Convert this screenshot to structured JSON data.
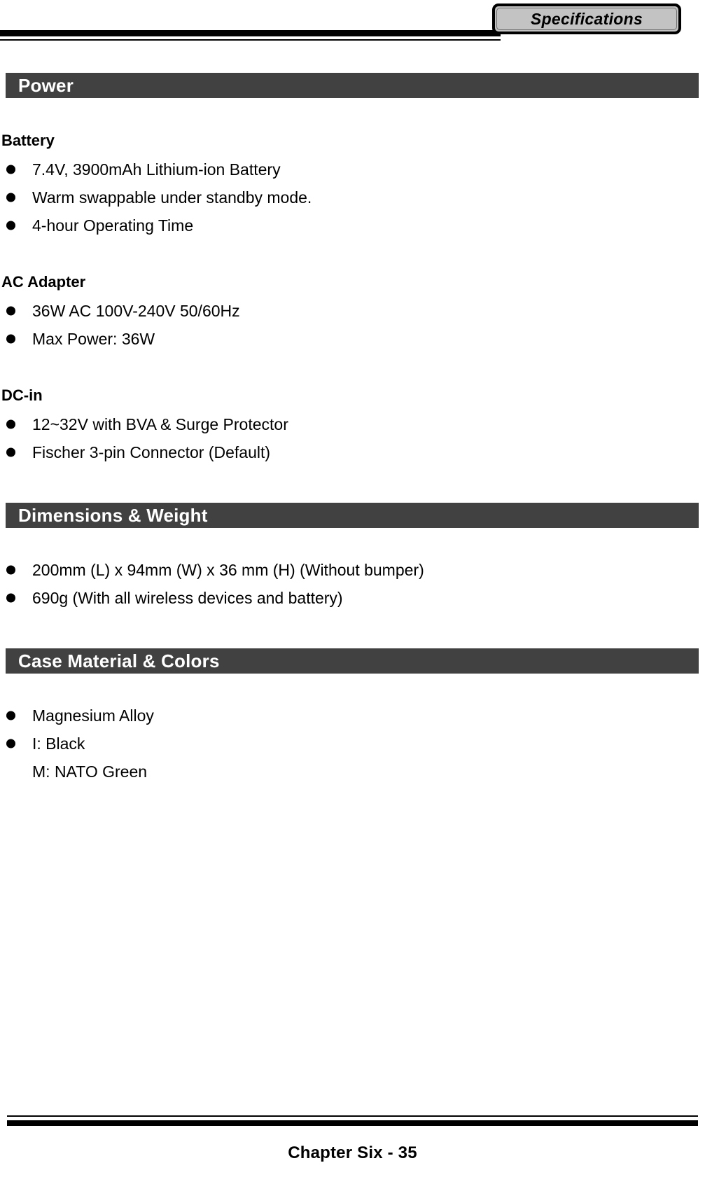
{
  "header": {
    "tab_label": "Specifications"
  },
  "sections": [
    {
      "id": "power",
      "bar_title": "Power",
      "groups": [
        {
          "title": "Battery",
          "items": [
            "7.4V, 3900mAh Lithium-ion Battery",
            "Warm swappable under standby mode.",
            "4-hour Operating Time"
          ]
        },
        {
          "title": "AC Adapter",
          "items": [
            "36W AC 100V-240V 50/60Hz",
            "Max Power: 36W"
          ]
        },
        {
          "title": "DC-in",
          "items": [
            "12~32V with BVA & Surge Protector",
            "Fischer 3-pin Connector (Default)"
          ]
        }
      ]
    },
    {
      "id": "dimensions",
      "bar_title": "Dimensions & Weight",
      "groups": [
        {
          "title": "",
          "items": [
            "200mm (L) x 94mm (W) x 36 mm (H) (Without bumper)",
            "690g (With all wireless devices and battery)"
          ]
        }
      ]
    },
    {
      "id": "case",
      "bar_title": "Case Material & Colors",
      "groups": [
        {
          "title": "",
          "items": [
            "Magnesium Alloy",
            "I: Black"
          ],
          "plain_items": [
            "M: NATO Green"
          ]
        }
      ]
    }
  ],
  "footer": {
    "page_label": "Chapter Six - 35"
  }
}
